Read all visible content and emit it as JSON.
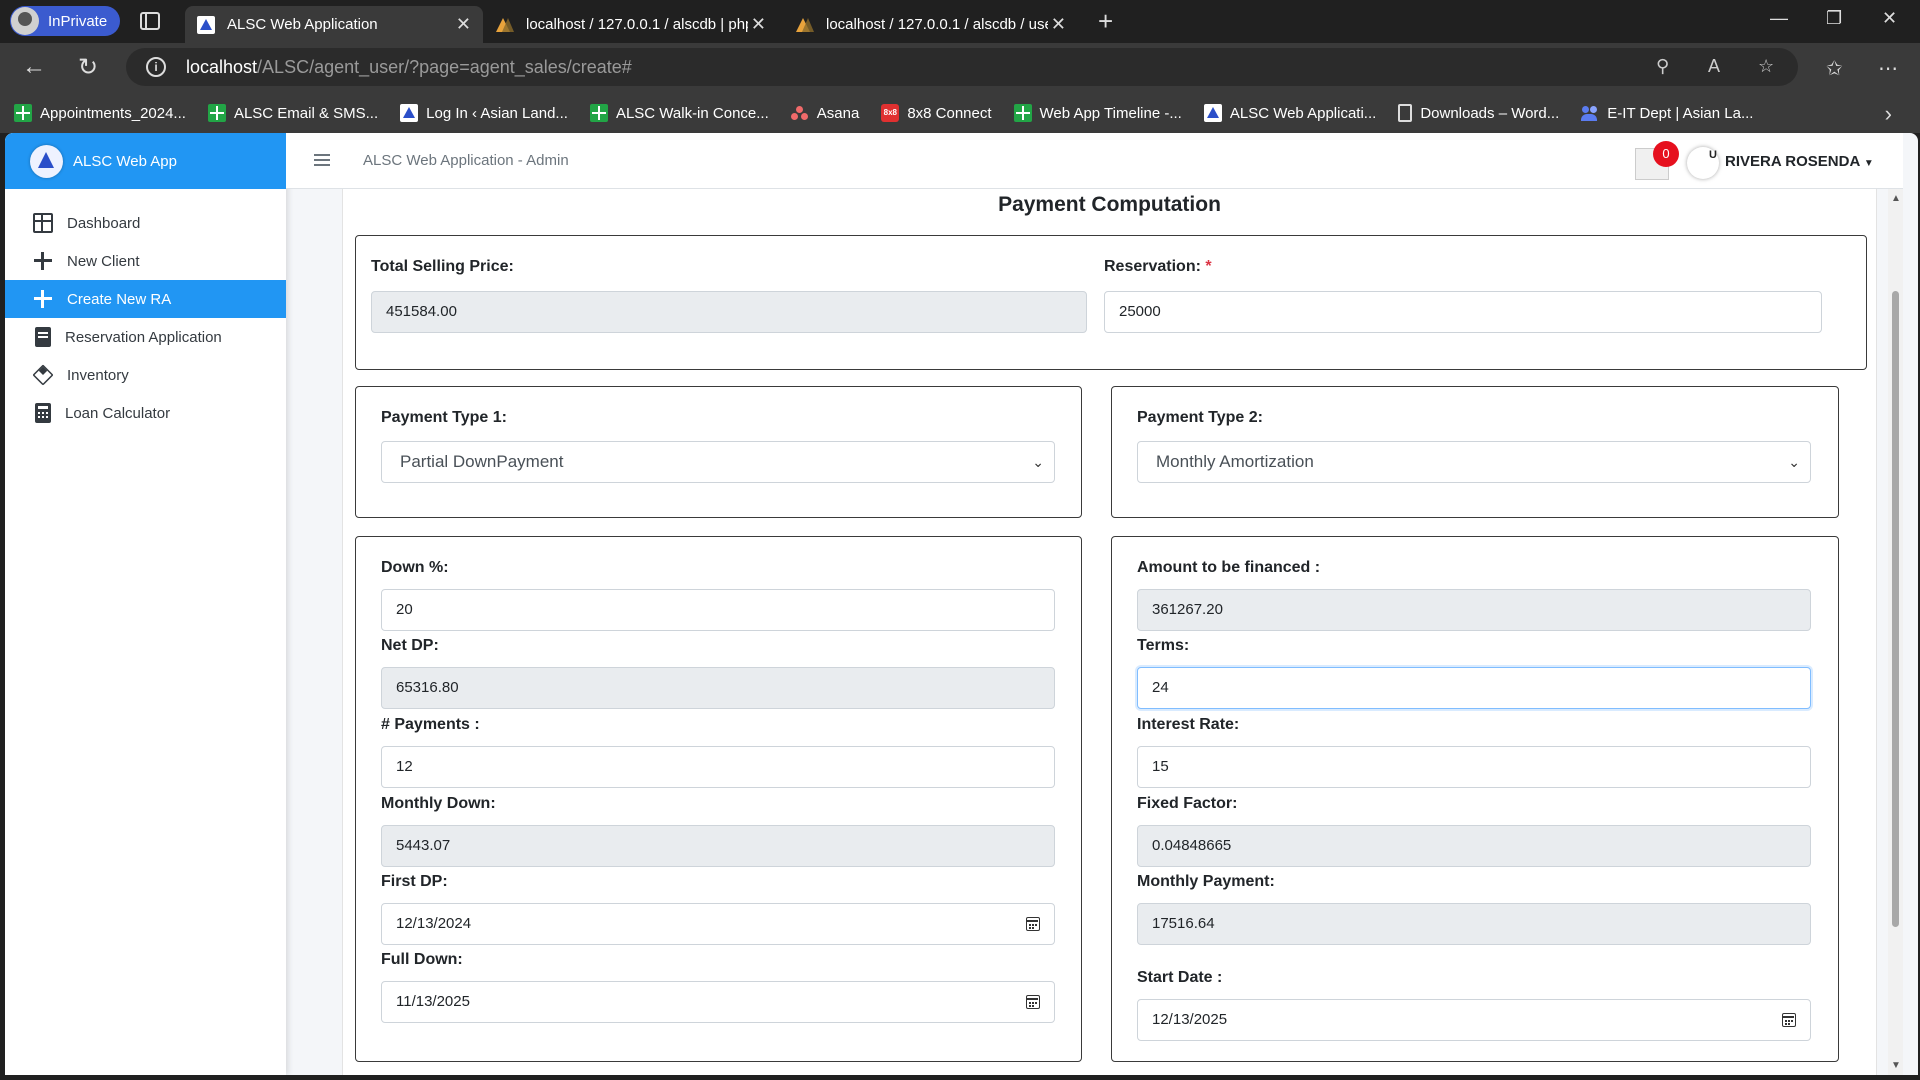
{
  "browser": {
    "inprivate_label": "InPrivate",
    "tabs": [
      {
        "title": "ALSC Web Application",
        "active": true
      },
      {
        "title": "localhost / 127.0.0.1 / alscdb | php",
        "active": false
      },
      {
        "title": "localhost / 127.0.0.1 / alscdb / use",
        "active": false
      }
    ],
    "url_host": "localhost",
    "url_path": "/ALSC/agent_user/?page=agent_sales/create#",
    "bookmarks": [
      {
        "label": "Appointments_2024...",
        "icon": "sheets-icon"
      },
      {
        "label": "ALSC Email & SMS...",
        "icon": "sheets-icon"
      },
      {
        "label": "Log In ‹ Asian Land...",
        "icon": "alsc-icon"
      },
      {
        "label": "ALSC Walk-in Conce...",
        "icon": "sheets-icon"
      },
      {
        "label": "Asana",
        "icon": "asana-icon"
      },
      {
        "label": "8x8 Connect",
        "icon": "8x8-icon"
      },
      {
        "label": "Web App Timeline -...",
        "icon": "sheets-icon"
      },
      {
        "label": "ALSC Web Applicati...",
        "icon": "alsc-icon"
      },
      {
        "label": "Downloads – Word...",
        "icon": "document-icon"
      },
      {
        "label": "E-IT Dept | Asian La...",
        "icon": "people-icon"
      }
    ]
  },
  "app": {
    "brand": "ALSC Web App",
    "site_title": "ALSC Web Application - Admin",
    "notification_count": "0",
    "avatar_text": "U",
    "user_name": "RIVERA ROSENDA",
    "accent_color": "#2196f3",
    "sidebar": [
      {
        "label": "Dashboard",
        "icon": "dashboard-icon",
        "active": false
      },
      {
        "label": "New Client",
        "icon": "plus-icon",
        "active": false
      },
      {
        "label": "Create New RA",
        "icon": "plus-icon",
        "active": true
      },
      {
        "label": "Reservation Application",
        "icon": "book-icon",
        "active": false
      },
      {
        "label": "Inventory",
        "icon": "box-icon",
        "active": false
      },
      {
        "label": "Loan Calculator",
        "icon": "calculator-icon",
        "active": false
      }
    ]
  },
  "form": {
    "title": "Payment Computation",
    "total_selling_price": {
      "label": "Total Selling Price:",
      "value": "451584.00"
    },
    "reservation": {
      "label": "Reservation:",
      "required_mark": "*",
      "value": "25000"
    },
    "payment_type_1": {
      "label": "Payment Type 1:",
      "value": "Partial DownPayment"
    },
    "payment_type_2": {
      "label": "Payment Type 2:",
      "value": "Monthly Amortization"
    },
    "down_percent": {
      "label": "Down %:",
      "value": "20"
    },
    "net_dp": {
      "label": "Net DP:",
      "value": "65316.80"
    },
    "num_payments": {
      "label": "# Payments :",
      "value": "12"
    },
    "monthly_down": {
      "label": "Monthly Down:",
      "value": "5443.07"
    },
    "first_dp": {
      "label": "First DP:",
      "value": "12/13/2024"
    },
    "full_down": {
      "label": "Full Down:",
      "value": "11/13/2025"
    },
    "amount_financed": {
      "label": "Amount to be financed :",
      "value": "361267.20"
    },
    "terms": {
      "label": "Terms:",
      "value": "24"
    },
    "interest_rate": {
      "label": "Interest Rate:",
      "value": "15"
    },
    "fixed_factor": {
      "label": "Fixed Factor:",
      "value": "0.04848665"
    },
    "monthly_payment": {
      "label": "Monthly Payment:",
      "value": "17516.64"
    },
    "start_date": {
      "label": "Start Date :",
      "value": "12/13/2025"
    }
  }
}
